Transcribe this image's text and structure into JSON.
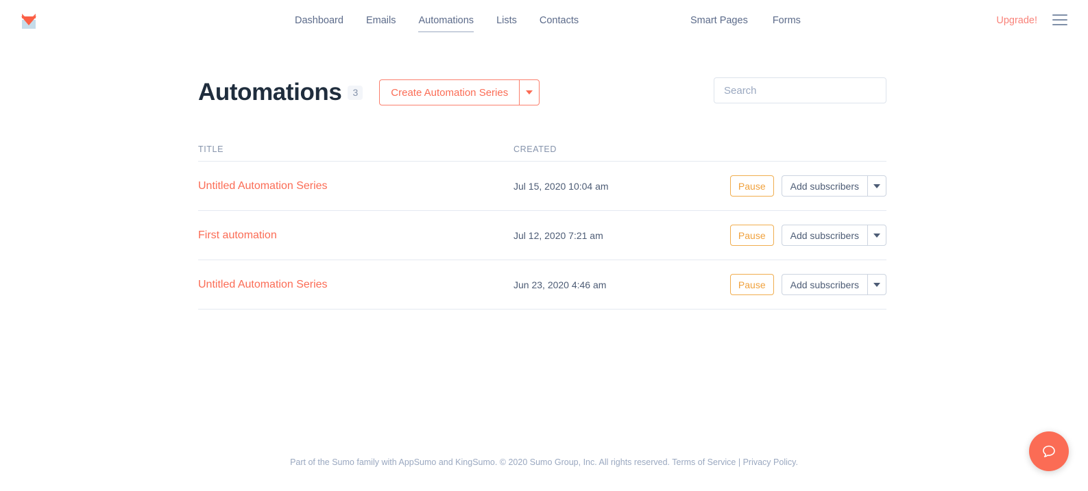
{
  "brand": {
    "logo_icon": "sumo-fox-envelope-logo",
    "accent_color": "#fb6c55",
    "nav_text_color": "#5c6b8a",
    "warning_color": "#f0ad4e"
  },
  "header": {
    "nav_center": [
      {
        "label": "Dashboard",
        "active": false
      },
      {
        "label": "Emails",
        "active": false
      },
      {
        "label": "Automations",
        "active": true
      },
      {
        "label": "Lists",
        "active": false
      },
      {
        "label": "Contacts",
        "active": false
      }
    ],
    "nav_right": [
      {
        "label": "Smart Pages"
      },
      {
        "label": "Forms"
      }
    ],
    "upgrade_label": "Upgrade!",
    "menu_icon": "hamburger-menu-icon"
  },
  "main": {
    "title": "Automations",
    "count": "3",
    "create_button_label": "Create Automation Series",
    "create_caret_icon": "chevron-down-icon",
    "search_placeholder": "Search",
    "search_value": ""
  },
  "table": {
    "columns": [
      "TITLE",
      "CREATED"
    ],
    "rows": [
      {
        "title": "Untitled Automation Series",
        "created": "Jul 15, 2020 10:04 am",
        "pause_label": "Pause",
        "subscribers_label": "Add subscribers",
        "caret_icon": "chevron-down-icon"
      },
      {
        "title": "First automation",
        "created": "Jul 12, 2020 7:21 am",
        "pause_label": "Pause",
        "subscribers_label": "Add subscribers",
        "caret_icon": "chevron-down-icon"
      },
      {
        "title": "Untitled Automation Series",
        "created": "Jun 23, 2020 4:46 am",
        "pause_label": "Pause",
        "subscribers_label": "Add subscribers",
        "caret_icon": "chevron-down-icon"
      }
    ]
  },
  "footer": {
    "text_before": "Part of the Sumo family with AppSumo and KingSumo. © 2020 Sumo Group, Inc. All rights reserved.",
    "terms_label": "Terms of Service",
    "separator": "|",
    "privacy_label": "Privacy Policy.",
    "help_icon": "chat-bubble-icon"
  }
}
